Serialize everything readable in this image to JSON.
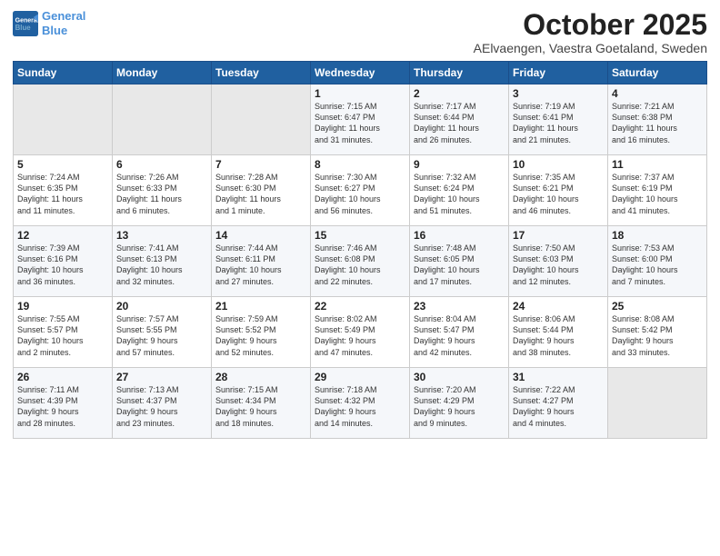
{
  "header": {
    "logo_line1": "General",
    "logo_line2": "Blue",
    "month": "October 2025",
    "location": "AElvaengen, Vaestra Goetaland, Sweden"
  },
  "days_of_week": [
    "Sunday",
    "Monday",
    "Tuesday",
    "Wednesday",
    "Thursday",
    "Friday",
    "Saturday"
  ],
  "weeks": [
    [
      {
        "num": "",
        "info": ""
      },
      {
        "num": "",
        "info": ""
      },
      {
        "num": "",
        "info": ""
      },
      {
        "num": "1",
        "info": "Sunrise: 7:15 AM\nSunset: 6:47 PM\nDaylight: 11 hours\nand 31 minutes."
      },
      {
        "num": "2",
        "info": "Sunrise: 7:17 AM\nSunset: 6:44 PM\nDaylight: 11 hours\nand 26 minutes."
      },
      {
        "num": "3",
        "info": "Sunrise: 7:19 AM\nSunset: 6:41 PM\nDaylight: 11 hours\nand 21 minutes."
      },
      {
        "num": "4",
        "info": "Sunrise: 7:21 AM\nSunset: 6:38 PM\nDaylight: 11 hours\nand 16 minutes."
      }
    ],
    [
      {
        "num": "5",
        "info": "Sunrise: 7:24 AM\nSunset: 6:35 PM\nDaylight: 11 hours\nand 11 minutes."
      },
      {
        "num": "6",
        "info": "Sunrise: 7:26 AM\nSunset: 6:33 PM\nDaylight: 11 hours\nand 6 minutes."
      },
      {
        "num": "7",
        "info": "Sunrise: 7:28 AM\nSunset: 6:30 PM\nDaylight: 11 hours\nand 1 minute."
      },
      {
        "num": "8",
        "info": "Sunrise: 7:30 AM\nSunset: 6:27 PM\nDaylight: 10 hours\nand 56 minutes."
      },
      {
        "num": "9",
        "info": "Sunrise: 7:32 AM\nSunset: 6:24 PM\nDaylight: 10 hours\nand 51 minutes."
      },
      {
        "num": "10",
        "info": "Sunrise: 7:35 AM\nSunset: 6:21 PM\nDaylight: 10 hours\nand 46 minutes."
      },
      {
        "num": "11",
        "info": "Sunrise: 7:37 AM\nSunset: 6:19 PM\nDaylight: 10 hours\nand 41 minutes."
      }
    ],
    [
      {
        "num": "12",
        "info": "Sunrise: 7:39 AM\nSunset: 6:16 PM\nDaylight: 10 hours\nand 36 minutes."
      },
      {
        "num": "13",
        "info": "Sunrise: 7:41 AM\nSunset: 6:13 PM\nDaylight: 10 hours\nand 32 minutes."
      },
      {
        "num": "14",
        "info": "Sunrise: 7:44 AM\nSunset: 6:11 PM\nDaylight: 10 hours\nand 27 minutes."
      },
      {
        "num": "15",
        "info": "Sunrise: 7:46 AM\nSunset: 6:08 PM\nDaylight: 10 hours\nand 22 minutes."
      },
      {
        "num": "16",
        "info": "Sunrise: 7:48 AM\nSunset: 6:05 PM\nDaylight: 10 hours\nand 17 minutes."
      },
      {
        "num": "17",
        "info": "Sunrise: 7:50 AM\nSunset: 6:03 PM\nDaylight: 10 hours\nand 12 minutes."
      },
      {
        "num": "18",
        "info": "Sunrise: 7:53 AM\nSunset: 6:00 PM\nDaylight: 10 hours\nand 7 minutes."
      }
    ],
    [
      {
        "num": "19",
        "info": "Sunrise: 7:55 AM\nSunset: 5:57 PM\nDaylight: 10 hours\nand 2 minutes."
      },
      {
        "num": "20",
        "info": "Sunrise: 7:57 AM\nSunset: 5:55 PM\nDaylight: 9 hours\nand 57 minutes."
      },
      {
        "num": "21",
        "info": "Sunrise: 7:59 AM\nSunset: 5:52 PM\nDaylight: 9 hours\nand 52 minutes."
      },
      {
        "num": "22",
        "info": "Sunrise: 8:02 AM\nSunset: 5:49 PM\nDaylight: 9 hours\nand 47 minutes."
      },
      {
        "num": "23",
        "info": "Sunrise: 8:04 AM\nSunset: 5:47 PM\nDaylight: 9 hours\nand 42 minutes."
      },
      {
        "num": "24",
        "info": "Sunrise: 8:06 AM\nSunset: 5:44 PM\nDaylight: 9 hours\nand 38 minutes."
      },
      {
        "num": "25",
        "info": "Sunrise: 8:08 AM\nSunset: 5:42 PM\nDaylight: 9 hours\nand 33 minutes."
      }
    ],
    [
      {
        "num": "26",
        "info": "Sunrise: 7:11 AM\nSunset: 4:39 PM\nDaylight: 9 hours\nand 28 minutes."
      },
      {
        "num": "27",
        "info": "Sunrise: 7:13 AM\nSunset: 4:37 PM\nDaylight: 9 hours\nand 23 minutes."
      },
      {
        "num": "28",
        "info": "Sunrise: 7:15 AM\nSunset: 4:34 PM\nDaylight: 9 hours\nand 18 minutes."
      },
      {
        "num": "29",
        "info": "Sunrise: 7:18 AM\nSunset: 4:32 PM\nDaylight: 9 hours\nand 14 minutes."
      },
      {
        "num": "30",
        "info": "Sunrise: 7:20 AM\nSunset: 4:29 PM\nDaylight: 9 hours\nand 9 minutes."
      },
      {
        "num": "31",
        "info": "Sunrise: 7:22 AM\nSunset: 4:27 PM\nDaylight: 9 hours\nand 4 minutes."
      },
      {
        "num": "",
        "info": ""
      }
    ]
  ]
}
